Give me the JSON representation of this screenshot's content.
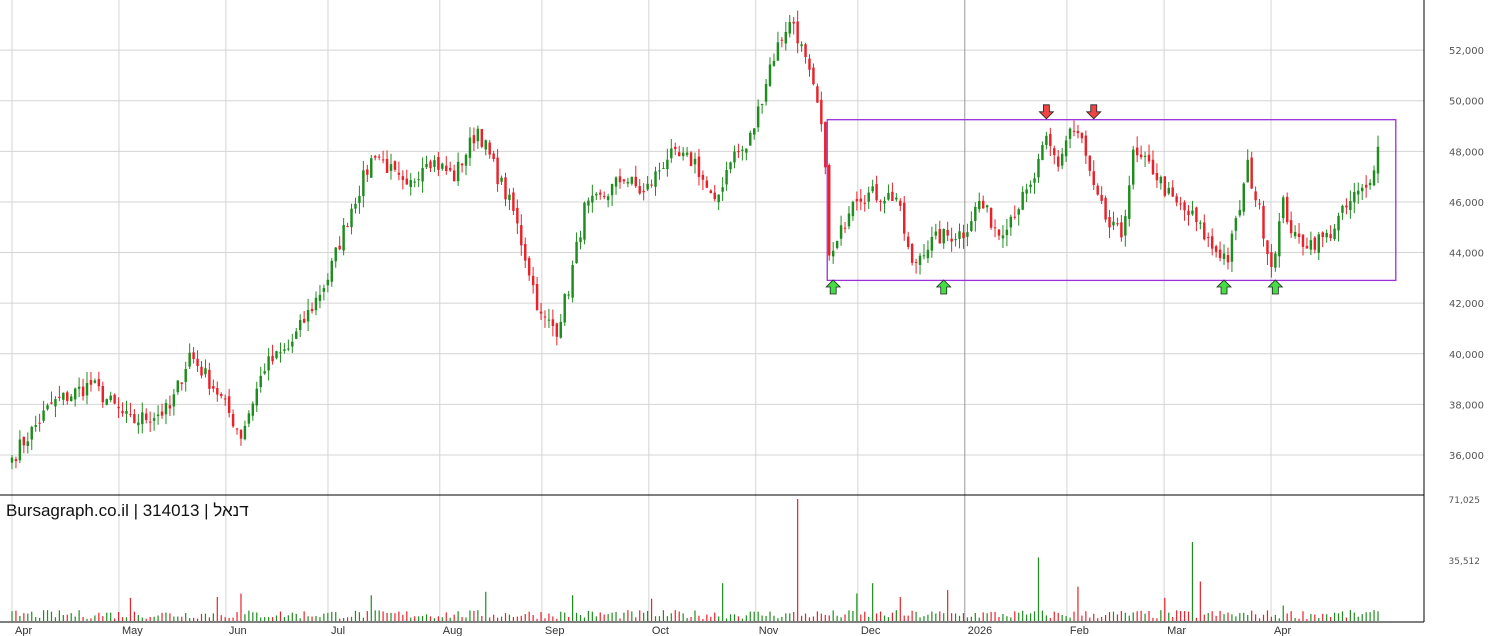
{
  "header": {
    "title": "Bursagraph.co.il | 314013 | דנאל"
  },
  "chart_data": {
    "type": "candlestick",
    "price_axis": {
      "ylim": [
        34500,
        53900
      ],
      "ticks": [
        36000,
        38000,
        40000,
        42000,
        44000,
        46000,
        48000,
        50000,
        52000
      ],
      "tick_labels": [
        "36,000",
        "38,000",
        "40,000",
        "42,000",
        "44,000",
        "46,000",
        "48,000",
        "50,000",
        "52,000"
      ]
    },
    "volume_axis": {
      "ylim": [
        0,
        71025
      ],
      "ticks": [
        35512,
        71025
      ],
      "tick_labels": [
        "35,512",
        "71,025"
      ]
    },
    "months": [
      "Apr",
      "May",
      "Jun",
      "Jul",
      "Aug",
      "Sep",
      "Oct",
      "Nov",
      "Dec",
      "2026",
      "Feb",
      "Mar",
      "Apr"
    ],
    "grid": true,
    "colors": {
      "up": "#1e8c1e",
      "down": "#e8222a",
      "range_box": "#9b30d9",
      "support_arrow": "#44dd44",
      "resistance_arrow": "#ee4444"
    },
    "close_anchors": [
      [
        0,
        35900
      ],
      [
        10,
        38000
      ],
      [
        20,
        38800
      ],
      [
        30,
        37300
      ],
      [
        40,
        37800
      ],
      [
        45,
        40000
      ],
      [
        52,
        38500
      ],
      [
        58,
        36800
      ],
      [
        64,
        39500
      ],
      [
        70,
        40200
      ],
      [
        74,
        41300
      ],
      [
        80,
        43000
      ],
      [
        86,
        45800
      ],
      [
        92,
        48000
      ],
      [
        100,
        46400
      ],
      [
        105,
        47800
      ],
      [
        112,
        47000
      ],
      [
        118,
        48900
      ],
      [
        122,
        47400
      ],
      [
        127,
        45600
      ],
      [
        131,
        43300
      ],
      [
        134,
        41400
      ],
      [
        138,
        41000
      ],
      [
        141,
        42600
      ],
      [
        145,
        45700
      ],
      [
        149,
        46100
      ],
      [
        155,
        47000
      ],
      [
        160,
        46300
      ],
      [
        166,
        47800
      ],
      [
        173,
        47600
      ],
      [
        178,
        45800
      ],
      [
        182,
        47800
      ],
      [
        186,
        48100
      ],
      [
        188,
        49000
      ],
      [
        192,
        51400
      ],
      [
        196,
        52900
      ],
      [
        198,
        53100
      ],
      [
        201,
        51500
      ],
      [
        204,
        49800
      ],
      [
        206,
        47700
      ],
      [
        207,
        43700
      ],
      [
        209,
        44300
      ],
      [
        213,
        46300
      ],
      [
        218,
        46300
      ],
      [
        224,
        46200
      ],
      [
        228,
        43400
      ],
      [
        231,
        44200
      ],
      [
        235,
        44600
      ],
      [
        241,
        44800
      ],
      [
        245,
        46000
      ],
      [
        250,
        44800
      ],
      [
        254,
        45700
      ],
      [
        258,
        46500
      ],
      [
        262,
        48400
      ],
      [
        265,
        47500
      ],
      [
        268,
        48900
      ],
      [
        271,
        48400
      ],
      [
        274,
        46400
      ],
      [
        278,
        45000
      ],
      [
        281,
        44700
      ],
      [
        284,
        47800
      ],
      [
        289,
        47300
      ],
      [
        294,
        46000
      ],
      [
        299,
        45400
      ],
      [
        304,
        44200
      ],
      [
        308,
        43800
      ],
      [
        311,
        45800
      ],
      [
        313,
        47400
      ],
      [
        316,
        45600
      ],
      [
        319,
        43500
      ],
      [
        322,
        45900
      ],
      [
        325,
        44500
      ],
      [
        329,
        44400
      ],
      [
        333,
        44600
      ],
      [
        336,
        45300
      ],
      [
        340,
        46200
      ],
      [
        343,
        46500
      ],
      [
        346,
        48100
      ]
    ],
    "range_box": {
      "high": 49250,
      "low": 42900,
      "start_index": 207,
      "end_index": 350
    },
    "support_arrows": [
      {
        "index": 208,
        "price": 42600
      },
      {
        "index": 236,
        "price": 42600
      },
      {
        "index": 307,
        "price": 42600
      },
      {
        "index": 320,
        "price": 42600
      }
    ],
    "resistance_arrows": [
      {
        "index": 262,
        "price": 49600
      },
      {
        "index": 274,
        "price": 49600
      }
    ],
    "volume_spikes": [
      [
        199,
        71025
      ],
      [
        260,
        37000
      ],
      [
        299,
        46000
      ],
      [
        301,
        23000
      ],
      [
        270,
        20000
      ],
      [
        180,
        22000
      ],
      [
        218,
        22000
      ],
      [
        237,
        18000
      ],
      [
        58,
        16000
      ],
      [
        52,
        14000
      ],
      [
        120,
        17000
      ],
      [
        142,
        15000
      ],
      [
        162,
        13000
      ],
      [
        292,
        13500
      ],
      [
        322,
        9000
      ],
      [
        347,
        9000
      ],
      [
        214,
        16000
      ],
      [
        225,
        14000
      ],
      [
        91,
        15000
      ],
      [
        30,
        13500
      ]
    ]
  }
}
